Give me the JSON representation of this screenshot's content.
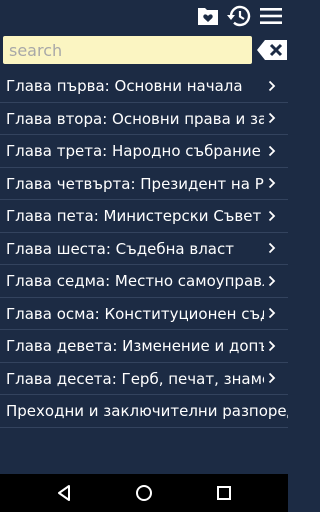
{
  "toolbar": {
    "icons": [
      "favorites-icon",
      "history-icon",
      "menu-icon"
    ]
  },
  "search": {
    "placeholder": "search",
    "value": ""
  },
  "chapters": [
    {
      "label": "Глава първа: Основни начала"
    },
    {
      "label": "Глава втора: Основни права и задължения на гражданите"
    },
    {
      "label": "Глава трета: Народно събрание"
    },
    {
      "label": "Глава четвърта: Президент на Републиката"
    },
    {
      "label": "Глава пета: Министерски Съвет"
    },
    {
      "label": "Глава шеста: Съдебна власт"
    },
    {
      "label": "Глава седма: Местно самоуправление и местна администрация"
    },
    {
      "label": "Глава осма: Конституционен съд"
    },
    {
      "label": "Глава девета: Изменение и допълнение на Конституцията"
    },
    {
      "label": "Глава десета: Герб, печат, знаме, химн, столица"
    },
    {
      "label": "Преходни и заключителни разпоредби"
    }
  ],
  "colors": {
    "background": "#1c2b44",
    "search_bg": "#fbf5c2",
    "divider": "#33435e",
    "navbar": "#000000"
  }
}
